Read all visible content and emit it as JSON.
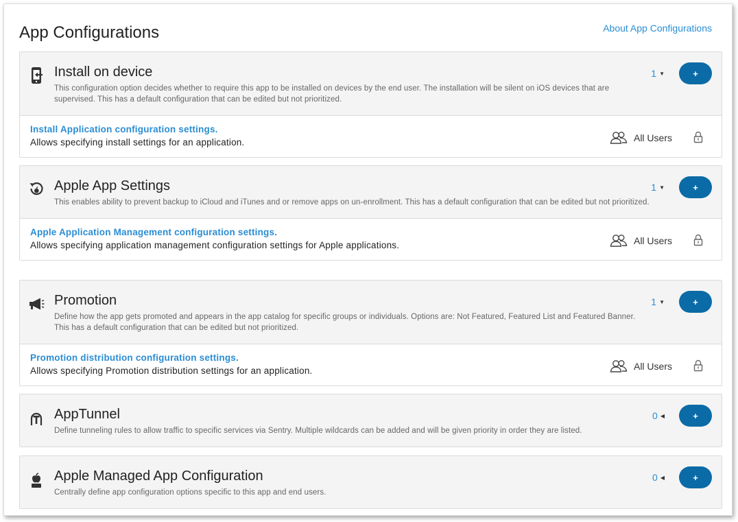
{
  "page": {
    "title": "App Configurations",
    "about_link": "About App Configurations"
  },
  "colors": {
    "accent": "#2a8dd4",
    "button": "#0b6ba6",
    "header_bg": "#f4f4f4"
  },
  "sections": [
    {
      "icon": "install-device-icon",
      "title": "Install on device",
      "description": "This configuration option decides whether to require this app to be installed on devices by the end user. The installation will be silent on iOS devices that are supervised. This has a default configuration that can be edited but not prioritized.",
      "count": "1",
      "count_caret": "▼",
      "add_label": "+",
      "row": {
        "link": "Install Application configuration settings.",
        "description": "Allows specifying install settings for an application.",
        "users": "All Users"
      }
    },
    {
      "icon": "apple-app-settings-icon",
      "title": "Apple App Settings",
      "description": "This enables ability to prevent backup to iCloud and iTunes and or remove apps on un-enrollment. This has a default configuration that can be edited but not prioritized.",
      "count": "1",
      "count_caret": "▼",
      "add_label": "+",
      "row": {
        "link": "Apple Application Management configuration settings.",
        "description": "Allows specifying application management configuration settings for Apple applications.",
        "users": "All Users"
      }
    },
    {
      "icon": "megaphone-icon",
      "title": "Promotion",
      "description": "Define how the app gets promoted and appears in the app catalog for specific groups or individuals. Options are: Not Featured, Featured List and Featured Banner. This has a default configuration that can be edited but not prioritized.",
      "count": "1",
      "count_caret": "▼",
      "add_label": "+",
      "row": {
        "link": "Promotion distribution configuration settings.",
        "description": "Allows specifying Promotion distribution settings for an application.",
        "users": "All Users"
      }
    },
    {
      "icon": "apptunnel-icon",
      "title": "AppTunnel",
      "description": "Define tunneling rules to allow traffic to specific services via Sentry. Multiple wildcards can be added and will be given priority in order they are listed.",
      "count": "0",
      "count_caret": "◀",
      "add_label": "+"
    },
    {
      "icon": "apple-managed-config-icon",
      "title": "Apple Managed App Configuration",
      "description": "Centrally define app configuration options specific to this app and end users.",
      "count": "0",
      "count_caret": "◀",
      "add_label": "+"
    }
  ]
}
